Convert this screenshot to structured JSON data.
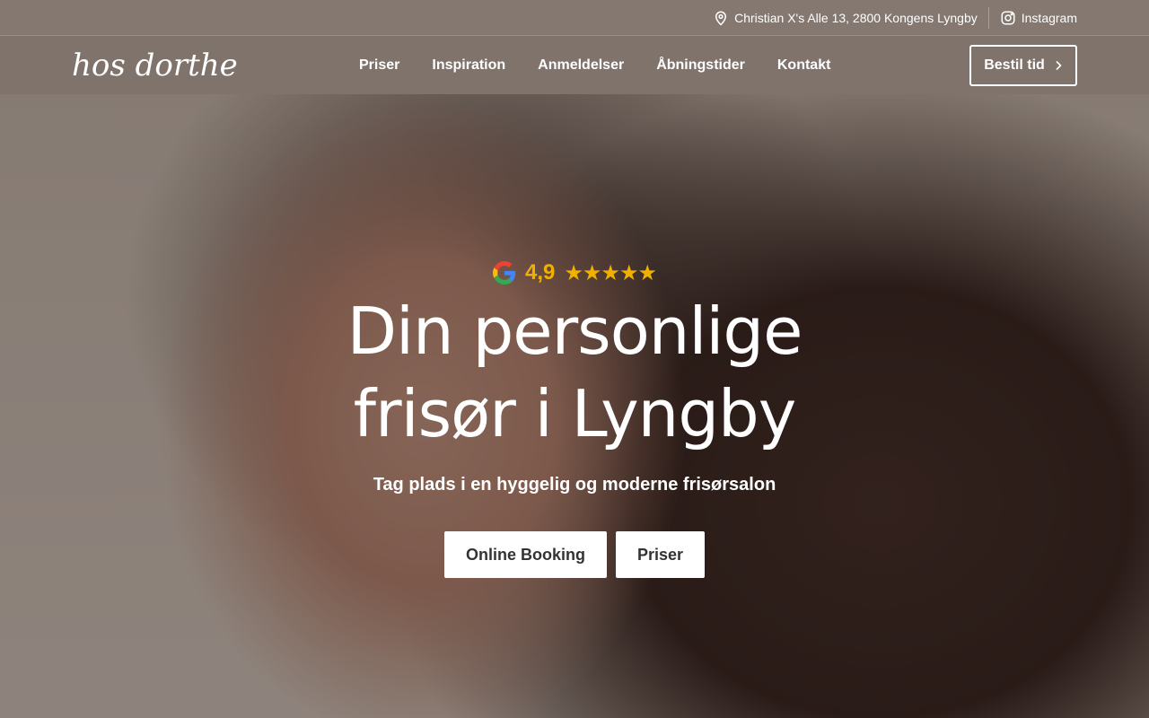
{
  "topbar": {
    "address": "Christian X's Alle 13, 2800 Kongens Lyngby",
    "address_icon": "map-pin-icon",
    "instagram_label": "Instagram",
    "instagram_icon": "instagram-icon"
  },
  "nav": {
    "logo": "hos dorthe",
    "links": [
      "Priser",
      "Inspiration",
      "Anmeldelser",
      "Åbningstider",
      "Kontakt"
    ],
    "cta_label": "Bestil tid",
    "cta_icon": "chevron-right-icon"
  },
  "hero": {
    "rating_icon": "google-icon",
    "rating_value": "4,9",
    "rating_stars": "★★★★★",
    "headline_line1": "Din personlige",
    "headline_line2": "frisør i Lyngby",
    "subline": "Tag plads i en hyggelig og moderne frisørsalon",
    "buttons": [
      "Online Booking",
      "Priser"
    ]
  },
  "colors": {
    "accent_star": "#f0b000",
    "nav_bg": "#80736b",
    "topbar_bg": "#857870"
  }
}
